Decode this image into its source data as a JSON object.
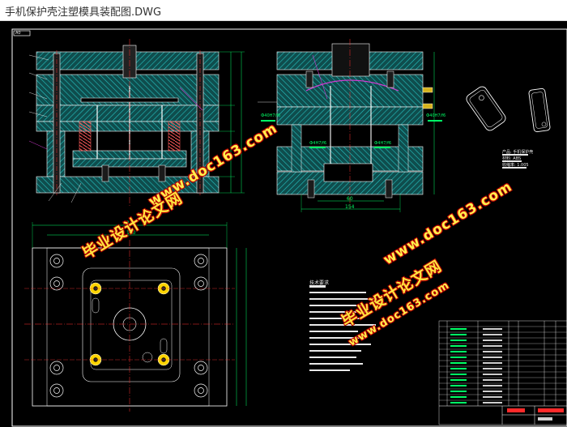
{
  "window": {
    "title": "手机保护壳注塑模具装配图.DWG"
  },
  "watermarks": {
    "brand_cn": "毕业设计论文网",
    "url": "www.doc163.com"
  },
  "drawing": {
    "sheet_tag": "A0",
    "plan_dim_top": "240",
    "plan_dim_inner": "170",
    "front_dim_left": "60",
    "front_dim_bottom": "154",
    "section_notes": [
      "Ф40H7/f6",
      "Ф40H7/f6",
      "Ф4H7/f6",
      "Ф4H7/f6"
    ],
    "part_notes": [
      "产品: 手机保护壳",
      "材料: ABS",
      "收缩率: 1.005"
    ],
    "tech_requirements_title": "技术要求"
  },
  "colors": {
    "background": "#000000",
    "hatch": "#19a4a4",
    "line": "#ffffff",
    "center": "#ff2a2a",
    "dimension": "#00ff66",
    "pin_highlight": "#ffd400",
    "leader_magenta": "#d23bd2"
  }
}
